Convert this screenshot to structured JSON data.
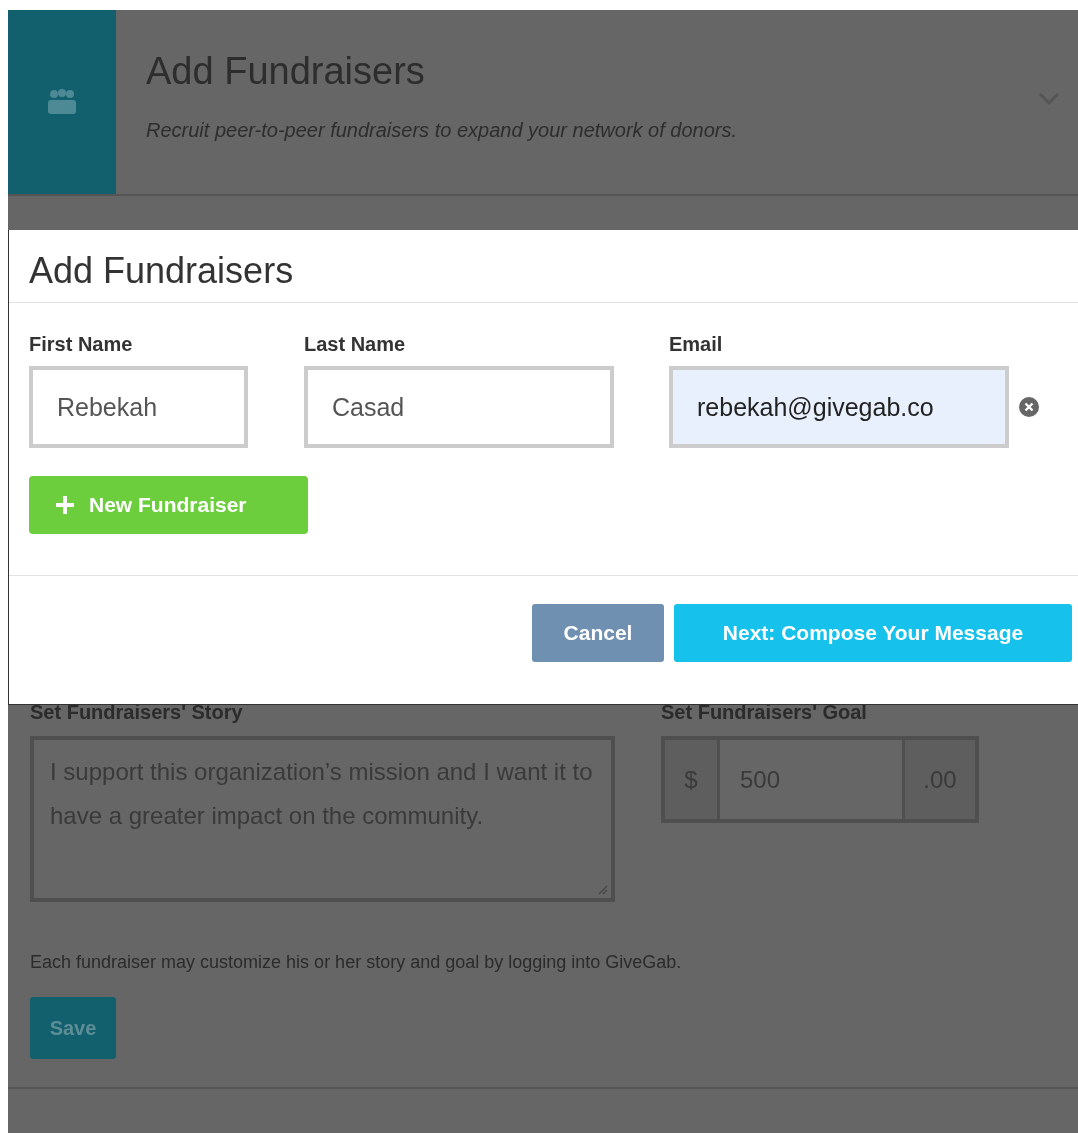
{
  "background_panel": {
    "title": "Add Fundraisers",
    "subtitle": "Recruit peer-to-peer fundraisers to expand your network of donors.",
    "story": {
      "label": "Set Fundraisers' Story",
      "value": "I support this organization’s mission and I want it to have a greater impact on the community."
    },
    "goal": {
      "label": "Set Fundraisers' Goal",
      "prefix": "$",
      "value": "500",
      "suffix": ".00"
    },
    "note": "Each fundraiser may customize his or her story and goal by logging into GiveGab.",
    "save_button": "Save"
  },
  "modal": {
    "title": "Add Fundraisers",
    "columns": [
      "First Name",
      "Last Name",
      "Email"
    ],
    "rows": [
      {
        "first_name": "Rebekah",
        "last_name": "Casad",
        "email": "rebekah@givegab.co"
      }
    ],
    "add_button": "New Fundraiser",
    "cancel_button": "Cancel",
    "next_button": "Next: Compose Your Message"
  }
}
